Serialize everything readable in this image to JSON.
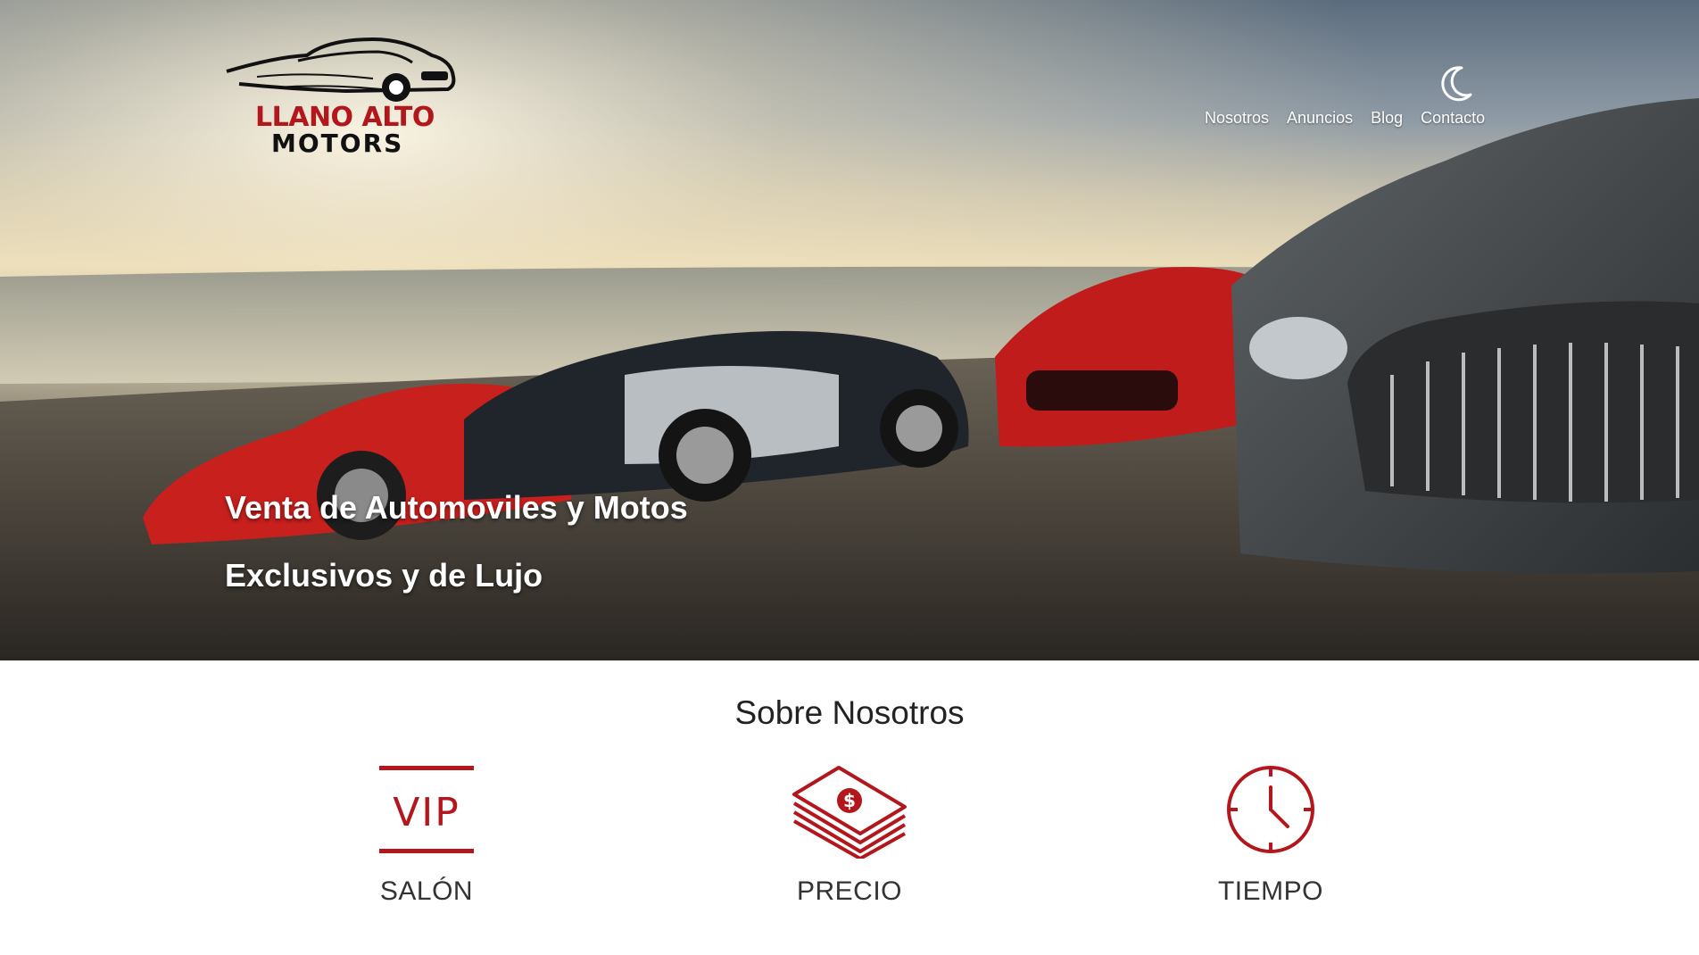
{
  "brand": {
    "line1": "LLANO ALTO",
    "line2": "MOTORS",
    "accent_color": "#b3161b"
  },
  "header": {
    "theme_toggle_icon": "moon-icon",
    "nav": [
      {
        "label": "Nosotros"
      },
      {
        "label": "Anuncios"
      },
      {
        "label": "Blog"
      },
      {
        "label": "Contacto"
      }
    ]
  },
  "hero": {
    "line1": "Venta de Automoviles y Motos",
    "line2": "Exclusivos y de Lujo"
  },
  "about": {
    "title": "Sobre Nosotros",
    "features": [
      {
        "label": "SALÓN",
        "icon": "vip-icon",
        "icon_text": "VIP"
      },
      {
        "label": "PRECIO",
        "icon": "money-stack-icon"
      },
      {
        "label": "TIEMPO",
        "icon": "clock-icon"
      }
    ]
  }
}
